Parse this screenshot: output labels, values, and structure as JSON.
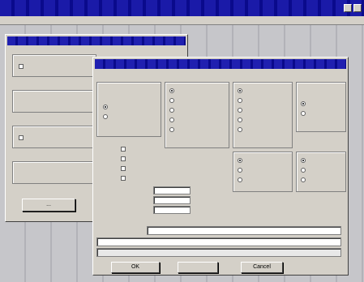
{
  "app": {
    "title": "",
    "controls": [
      "minimize",
      "maximize",
      "close"
    ]
  },
  "menu": [
    "",
    "",
    "",
    "",
    "",
    "",
    "",
    ""
  ],
  "back_window": {
    "title": "",
    "groups": [
      {
        "label": "",
        "fields": [
          "",
          ""
        ]
      },
      {
        "label": "",
        "fields": [
          "",
          ""
        ]
      },
      {
        "label": "",
        "fields": [
          "",
          ""
        ]
      },
      {
        "label": "",
        "fields": [
          "",
          ""
        ]
      }
    ],
    "button": "..."
  },
  "dialog": {
    "title": "",
    "subtitle": "",
    "group_a": {
      "label": "",
      "options": [
        "",
        ""
      ]
    },
    "group_b": {
      "label": "",
      "options": [
        "",
        "",
        "",
        "",
        ""
      ]
    },
    "group_c": {
      "label": "",
      "options": [
        "",
        "",
        "",
        "",
        ""
      ]
    },
    "group_d": {
      "label": "",
      "options": [
        "",
        ""
      ]
    },
    "group_e": {
      "label": "",
      "options": [
        "",
        "",
        ""
      ]
    },
    "group_f": {
      "label": "",
      "options": [
        "",
        "",
        ""
      ]
    },
    "checks": [
      "",
      "",
      "",
      ""
    ],
    "field_rows": [
      {
        "label": "",
        "value": ""
      },
      {
        "label": "",
        "value": ""
      },
      {
        "label": "",
        "value": ""
      }
    ],
    "section_label": "",
    "path_label": "",
    "path_value": "",
    "status_1": "",
    "status_2": "",
    "buttons": [
      "OK",
      "",
      "Cancel"
    ]
  }
}
